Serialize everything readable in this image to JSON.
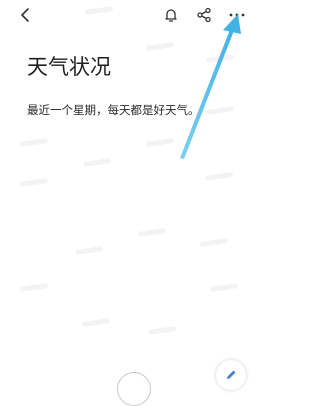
{
  "note": {
    "title": "天气状况",
    "body": "最近一个星期，每天都是好天气。"
  },
  "toolbar": {
    "back_icon": "back-arrow-icon",
    "reminder_icon": "bell-icon",
    "share_icon": "share-icon",
    "more_icon": "more-horizontal-icon"
  },
  "fab": {
    "icon": "pencil-edit-icon"
  },
  "annotation": {
    "color": "#4ab7e8",
    "points_to": "more-options-button"
  }
}
